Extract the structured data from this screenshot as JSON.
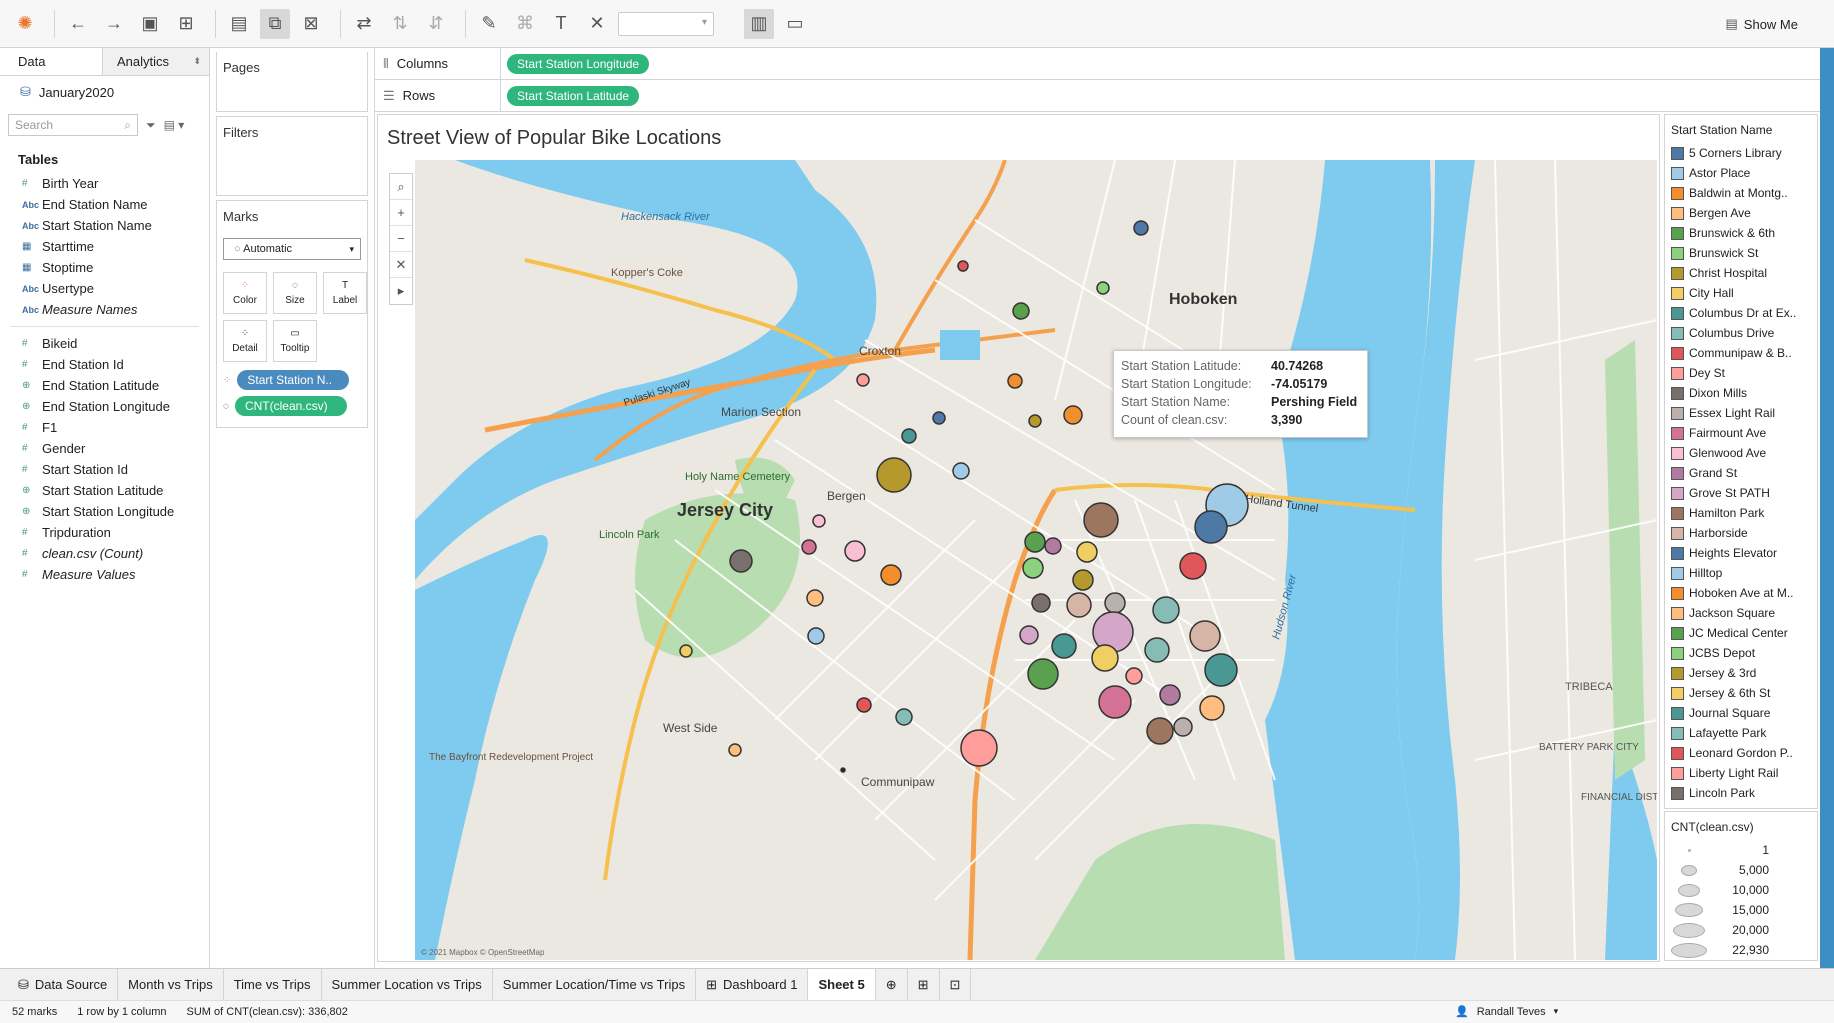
{
  "toolbar": {
    "show_me": "Show Me"
  },
  "data_pane": {
    "tabs": {
      "data": "Data",
      "analytics": "Analytics"
    },
    "datasource": "January2020",
    "search_placeholder": "Search",
    "tables_header": "Tables",
    "fields": [
      {
        "name": "Birth Year",
        "type": "measure"
      },
      {
        "name": "End Station Name",
        "type": "abc"
      },
      {
        "name": "Start Station Name",
        "type": "abc"
      },
      {
        "name": "Starttime",
        "type": "date"
      },
      {
        "name": "Stoptime",
        "type": "date"
      },
      {
        "name": "Usertype",
        "type": "abc"
      },
      {
        "name": "Measure Names",
        "type": "abc",
        "italic": true
      }
    ],
    "measures": [
      {
        "name": "Bikeid",
        "type": "measure"
      },
      {
        "name": "End Station Id",
        "type": "measure"
      },
      {
        "name": "End Station Latitude",
        "type": "geo"
      },
      {
        "name": "End Station Longitude",
        "type": "geo"
      },
      {
        "name": "F1",
        "type": "measure"
      },
      {
        "name": "Gender",
        "type": "measure"
      },
      {
        "name": "Start Station Id",
        "type": "measure"
      },
      {
        "name": "Start Station Latitude",
        "type": "geo"
      },
      {
        "name": "Start Station Longitude",
        "type": "geo"
      },
      {
        "name": "Tripduration",
        "type": "measure"
      },
      {
        "name": "clean.csv (Count)",
        "type": "measure",
        "italic": true
      },
      {
        "name": "Measure Values",
        "type": "measure",
        "italic": true
      }
    ]
  },
  "cards": {
    "pages": "Pages",
    "filters": "Filters",
    "marks": "Marks",
    "mark_type": "Automatic",
    "mark_buttons": [
      "Color",
      "Size",
      "Label",
      "Detail",
      "Tooltip"
    ],
    "pills": [
      "Start Station N..",
      "CNT(clean.csv)"
    ]
  },
  "shelves": {
    "columns_label": "Columns",
    "columns_pill": "Start Station Longitude",
    "rows_label": "Rows",
    "rows_pill": "Start Station Latitude"
  },
  "viz": {
    "title": "Street View of Popular Bike Locations",
    "map_labels": {
      "hoboken": "Hoboken",
      "jersey_city": "Jersey City",
      "croxton": "Croxton",
      "marion": "Marion Section",
      "bergen": "Bergen",
      "west_side": "West Side",
      "communipaw": "Communipaw",
      "lincoln_park": "Lincoln Park",
      "holy_name": "Holy Name Cemetery",
      "hackensack": "Hackensack River",
      "hudson": "Hudson River",
      "holland": "Holland Tunnel",
      "tribeca": "TRIBECA",
      "battery": "BATTERY PARK CITY",
      "financial": "FINANCIAL DISTRICT",
      "koppers": "Kopper's Coke",
      "bayfront": "The Bayfront Redevelopment Project",
      "pulaski": "Pulaski Skyway",
      "attribution": "© 2021 Mapbox © OpenStreetMap"
    },
    "tooltip": {
      "rows": [
        {
          "key": "Start Station Latitude:",
          "value": "40.74268"
        },
        {
          "key": "Start Station Longitude:",
          "value": "-74.05179"
        },
        {
          "key": "Start Station Name:",
          "value": "Pershing Field"
        },
        {
          "key": "Count of clean.csv:",
          "value": "3,390"
        }
      ]
    }
  },
  "legend": {
    "title": "Start Station Name",
    "items": [
      {
        "label": "5 Corners Library",
        "color": "#4e79a7"
      },
      {
        "label": "Astor Place",
        "color": "#a0cbe8"
      },
      {
        "label": "Baldwin at Montg..",
        "color": "#f28e2b"
      },
      {
        "label": "Bergen Ave",
        "color": "#ffbe7d"
      },
      {
        "label": "Brunswick & 6th",
        "color": "#59a14f"
      },
      {
        "label": "Brunswick St",
        "color": "#8cd17d"
      },
      {
        "label": "Christ Hospital",
        "color": "#b6992d"
      },
      {
        "label": "City Hall",
        "color": "#f1ce63"
      },
      {
        "label": "Columbus Dr at Ex..",
        "color": "#499894"
      },
      {
        "label": "Columbus Drive",
        "color": "#86bcb6"
      },
      {
        "label": "Communipaw & B..",
        "color": "#e15759"
      },
      {
        "label": "Dey St",
        "color": "#ff9d9a"
      },
      {
        "label": "Dixon Mills",
        "color": "#79706e"
      },
      {
        "label": "Essex Light Rail",
        "color": "#bab0ac"
      },
      {
        "label": "Fairmount Ave",
        "color": "#d37295"
      },
      {
        "label": "Glenwood Ave",
        "color": "#fabfd2"
      },
      {
        "label": "Grand St",
        "color": "#b07aa1"
      },
      {
        "label": "Grove St PATH",
        "color": "#d4a6c8"
      },
      {
        "label": "Hamilton Park",
        "color": "#9d7660"
      },
      {
        "label": "Harborside",
        "color": "#d7b5a6"
      },
      {
        "label": "Heights Elevator",
        "color": "#4e79a7"
      },
      {
        "label": "Hilltop",
        "color": "#a0cbe8"
      },
      {
        "label": "Hoboken Ave at M..",
        "color": "#f28e2b"
      },
      {
        "label": "Jackson Square",
        "color": "#ffbe7d"
      },
      {
        "label": "JC Medical Center",
        "color": "#59a14f"
      },
      {
        "label": "JCBS Depot",
        "color": "#8cd17d"
      },
      {
        "label": "Jersey & 3rd",
        "color": "#b6992d"
      },
      {
        "label": "Jersey & 6th St",
        "color": "#f1ce63"
      },
      {
        "label": "Journal Square",
        "color": "#499894"
      },
      {
        "label": "Lafayette Park",
        "color": "#86bcb6"
      },
      {
        "label": "Leonard Gordon P..",
        "color": "#e15759"
      },
      {
        "label": "Liberty Light Rail",
        "color": "#ff9d9a"
      },
      {
        "label": "Lincoln Park",
        "color": "#79706e"
      }
    ]
  },
  "size_legend": {
    "title": "CNT(clean.csv)",
    "items": [
      "1",
      "5,000",
      "10,000",
      "15,000",
      "20,000",
      "22,930"
    ]
  },
  "tabs": {
    "data_source": "Data Source",
    "sheets": [
      "Month vs Trips",
      "Time vs Trips",
      "Summer Location vs Trips",
      "Summer Location/Time vs Trips",
      "Dashboard 1",
      "Sheet 5"
    ]
  },
  "status": {
    "marks": "52 marks",
    "dims": "1 row by 1 column",
    "sum": "SUM of CNT(clean.csv): 336,802",
    "user": "Randall Teves"
  }
}
